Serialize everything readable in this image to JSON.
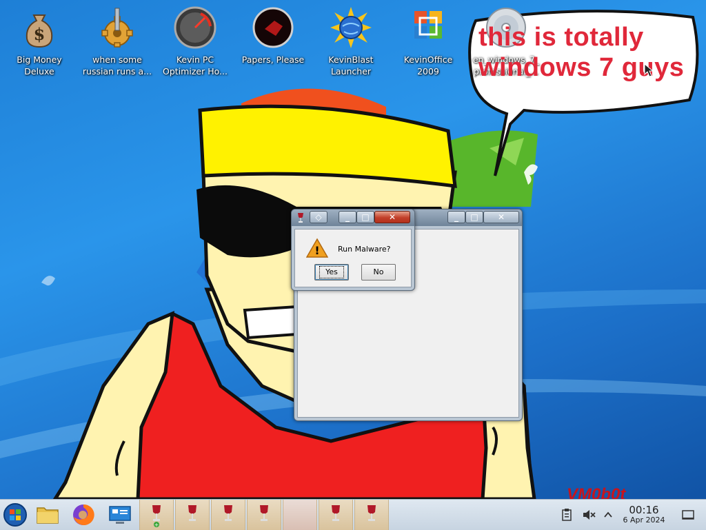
{
  "desktop": {
    "icons": [
      {
        "name": "Big Money Deluxe",
        "line1": "Big Money",
        "line2": "Deluxe",
        "icon": "money-bag-icon"
      },
      {
        "name": "when some russian runs a...",
        "line1": "when some",
        "line2": "russian runs a...",
        "icon": "gear-icon"
      },
      {
        "name": "Kevin PC Optimizer Ho...",
        "line1": "Kevin PC",
        "line2": "Optimizer Ho...",
        "icon": "speedometer-icon"
      },
      {
        "name": "Papers, Please",
        "line1": "Papers, Please",
        "line2": "",
        "icon": "papers-please-icon"
      },
      {
        "name": "KevinBlast Launcher",
        "line1": "KevinBlast",
        "line2": "Launcher",
        "icon": "globe-burst-icon"
      },
      {
        "name": "KevinOffice 2009",
        "line1": "KevinOffice",
        "line2": "2009",
        "icon": "office-icon"
      },
      {
        "name": "en_windows_7_professional_...",
        "line1": "en_windows_7_",
        "line2": "professional_...",
        "icon": "disc-icon"
      }
    ],
    "bubble_line1": "this is totally",
    "bubble_line2": "windows 7 guys",
    "watermark": "VM0b0t"
  },
  "dialog": {
    "message": "Run Malware?",
    "yes_label": "Yes",
    "no_label": "No",
    "icon": "warning-icon",
    "close_glyph": "✕"
  },
  "background_window": {
    "close_glyph": "✕"
  },
  "taskbar": {
    "start_icon": "start-orb-icon",
    "pinned": [
      "file-manager-icon",
      "firefox-icon",
      "system-settings-icon"
    ],
    "wine_tasks": 6,
    "time": "00:16",
    "date": "6 Apr 2024",
    "tray_icons": [
      "clipboard-icon",
      "volume-muted-icon",
      "tray-expand-icon",
      "show-desktop-icon"
    ]
  },
  "colors": {
    "wallpaper_blue": "#1e7fd6",
    "bubble_text": "#e0283a",
    "close_button": "#c2402a",
    "taskbar_wine": "#d9c39d"
  }
}
